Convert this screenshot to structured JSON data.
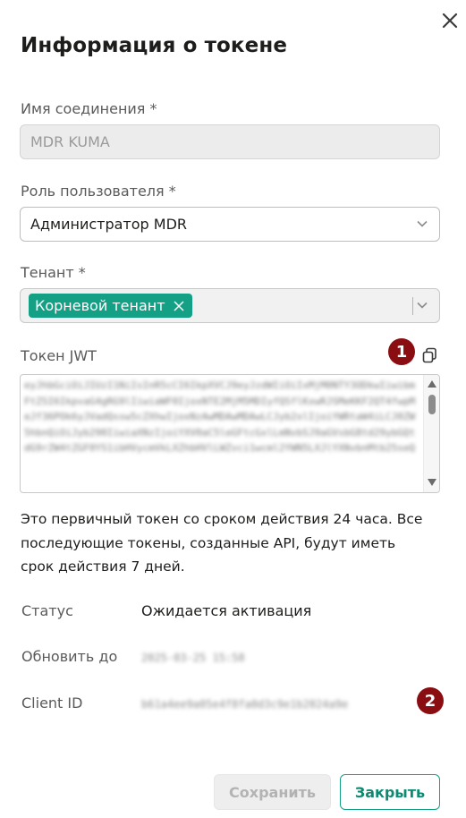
{
  "dialog": {
    "title": "Информация о токене",
    "close_icon": "close-icon"
  },
  "connection_name": {
    "label": "Имя соединения *",
    "value": "MDR KUMA"
  },
  "user_role": {
    "label": "Роль пользователя *",
    "value": "Администратор MDR"
  },
  "tenant": {
    "label": "Тенант *",
    "chip": "Корневой тенант"
  },
  "jwt_token": {
    "label": "Токен JWT",
    "value": "eyJhbGciOiJIUzI1NiIsInR5cCI6IkpXVCJ9eyJzdWIiOiIxMjM0NTY3ODkwIiwibmFtZSI6IkpvaG4gRG9lIiwiaWF0IjoxNTE2MjM5MDIyfQSflKxwRJSMeKKF2QT4fwpMeJf36POk6yJVadQssw5cZXhwIjoxNzAwMDAwMDAwLCJyb2xlIjoiYWRtaW4iLCJ0ZW5hbnQiOiJyb290IiwiaXNzIjoiYXV0aC5leGFtcGxlLmNvbSJ9aGVsbG8td29ybGQtdG9rZW4tZGF0YS1ibHVycmVkLXZhbHVlLWZvci1wcml2YWN5LXJlYXNvbnMtb25seQ"
  },
  "note": "Это первичный токен со сроком действия 24 часа. Все последующие токены, созданные API, будут иметь срок действия 7 дней.",
  "details": {
    "status_label": "Статус",
    "status_value": "Ожидается активация",
    "renew_label": "Обновить до",
    "renew_value": "2025-03-25 15:58",
    "client_id_label": "Client ID",
    "client_id_value": "b61a4ee9a05e4f8fa0d3c9e1b2024a9e"
  },
  "badges": {
    "one": "1",
    "two": "2"
  },
  "buttons": {
    "save": "Сохранить",
    "close": "Закрыть"
  },
  "colors": {
    "accent": "#14a085",
    "badge": "#8a0d12"
  }
}
